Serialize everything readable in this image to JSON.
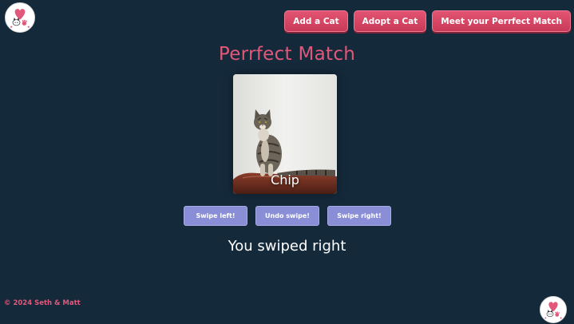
{
  "header": {
    "logo_icon": "cat-heart-logo-icon",
    "nav": [
      {
        "label": "Add a Cat"
      },
      {
        "label": "Adopt a Cat"
      },
      {
        "label": "Meet your Perrfect Match"
      }
    ]
  },
  "main": {
    "title": "Perrfect Match",
    "card": {
      "cat_name": "Chip",
      "photo_icon": "tabby-cat-photo"
    },
    "actions": {
      "swipe_left": "Swipe left!",
      "undo": "Undo swipe!",
      "swipe_right": "Swipe right!"
    },
    "result_text": "You swiped right"
  },
  "footer": {
    "copyright": "© 2024 Seth & Matt",
    "logo_icon": "cat-heart-logo-icon"
  },
  "colors": {
    "background": "#14293a",
    "accent_pink": "#e2587a",
    "button_lavender": "#8a8ed6",
    "text_white": "#ffffff"
  }
}
